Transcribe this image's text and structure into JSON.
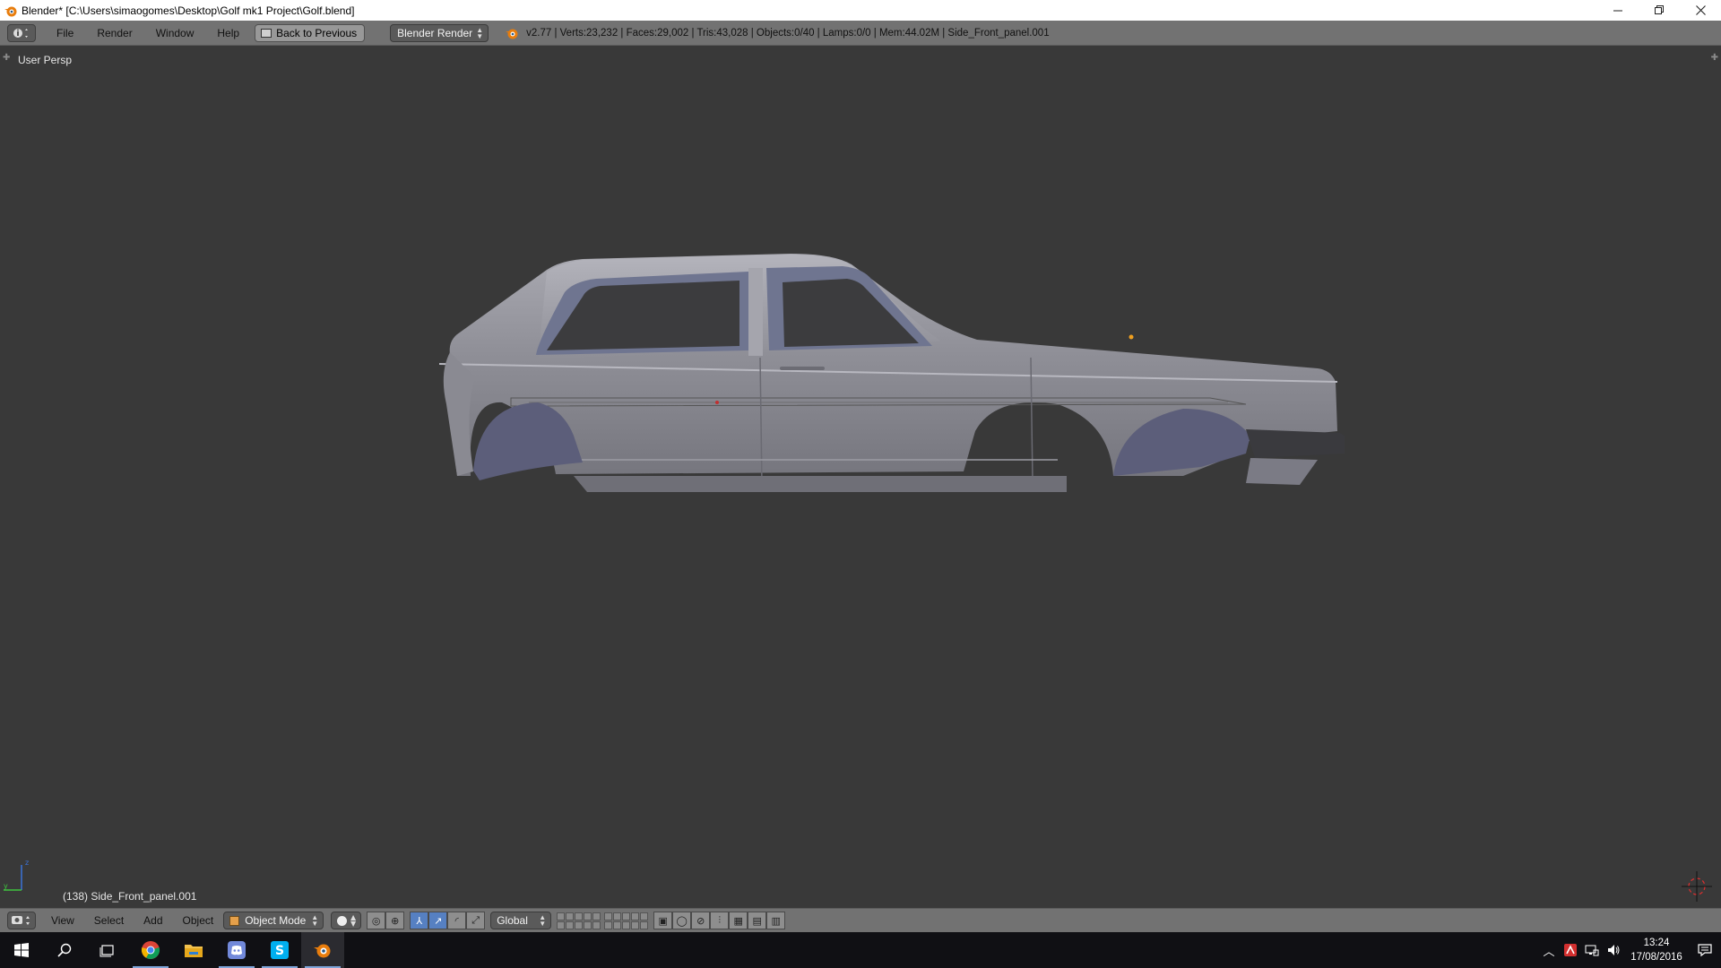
{
  "window": {
    "title": "Blender* [C:\\Users\\simaogomes\\Desktop\\Golf mk1 Project\\Golf.blend]",
    "controls": [
      "minimize",
      "restore",
      "close"
    ]
  },
  "info_header": {
    "menu": [
      "File",
      "Render",
      "Window",
      "Help"
    ],
    "back_button": "Back to Previous",
    "render_engine": "Blender Render",
    "stats": "v2.77 | Verts:23,232 | Faces:29,002 | Tris:43,028 | Objects:0/40 | Lamps:0/0 | Mem:44.02M | Side_Front_panel.001"
  },
  "viewport": {
    "view_label": "User Persp",
    "object_label": "(138) Side_Front_panel.001",
    "background_color": "#393939",
    "model_color": "#8c8c94"
  },
  "view3d_header": {
    "menu": [
      "View",
      "Select",
      "Add",
      "Object"
    ],
    "mode": "Object Mode",
    "orientation": "Global"
  },
  "taskbar": {
    "apps": [
      "start-icon",
      "search-icon",
      "task-view-icon",
      "chrome-icon",
      "file-explorer-icon",
      "discord-icon",
      "skype-icon",
      "blender-icon"
    ],
    "time": "13:24",
    "date": "17/08/2016"
  },
  "colors": {
    "header_bg": "#727272",
    "accent_blue": "#5680c2",
    "blender_orange": "#e87d0d"
  }
}
